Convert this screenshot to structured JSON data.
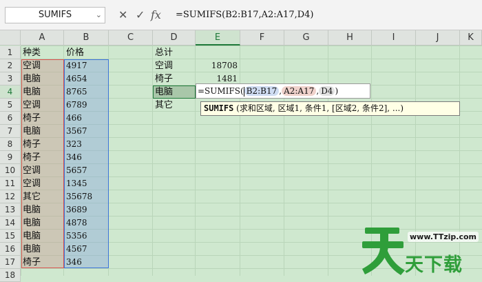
{
  "name_box": {
    "value": "SUMIFS"
  },
  "formula_bar": {
    "cancel_icon": "✕",
    "enter_icon": "✓",
    "fx_label": "fx",
    "formula": "=SUMIFS(B2:B17,A2:A17,D4)"
  },
  "columns": [
    "A",
    "B",
    "C",
    "D",
    "E",
    "F",
    "G",
    "H",
    "I",
    "J",
    "K"
  ],
  "rows": [
    "1",
    "2",
    "3",
    "4",
    "5",
    "6",
    "7",
    "8",
    "9",
    "10",
    "11",
    "12",
    "13",
    "14",
    "15",
    "16",
    "17",
    "18"
  ],
  "sheet": {
    "A": [
      "种类",
      "空调",
      "电脑",
      "电脑",
      "空调",
      "椅子",
      "电脑",
      "椅子",
      "椅子",
      "空调",
      "空调",
      "其它",
      "电脑",
      "电脑",
      "电脑",
      "电脑",
      "椅子"
    ],
    "B": [
      "价格",
      "4917",
      "4654",
      "8765",
      "6789",
      "466",
      "3567",
      "323",
      "346",
      "5657",
      "1345",
      "35678",
      "3689",
      "4878",
      "5356",
      "4567",
      "346"
    ],
    "D": [
      "总计",
      "空调",
      "椅子",
      "电脑",
      "其它"
    ],
    "E": [
      "",
      "18708",
      "1481",
      "",
      ""
    ]
  },
  "editing": {
    "prefix": "=SUMIFS(",
    "ref1": "B2:B17",
    "sep1": ",",
    "ref2": "A2:A17",
    "sep2": ",",
    "ref3": "D4",
    "suffix": ")"
  },
  "tooltip": {
    "func": "SUMIFS",
    "args": " (求和区域, 区域1, 条件1, [区域2, 条件2], ...)"
  },
  "watermark": {
    "url": "www.TTzip.com",
    "text": "天下载"
  }
}
